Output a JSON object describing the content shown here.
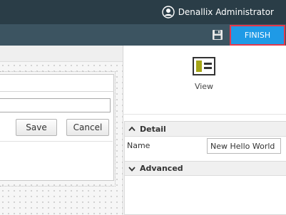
{
  "header": {
    "user_name": "Denallix Administrator",
    "avatar_icon": "user-circle-icon"
  },
  "toolbar": {
    "save_icon": "floppy-disk-icon",
    "finish_label": "FINISH",
    "finish_color": "#1f9ae6",
    "highlight_color": "#e5384a"
  },
  "canvas": {
    "text_input_value": "",
    "save_button_label": "Save",
    "cancel_button_label": "Cancel"
  },
  "side_panel": {
    "view_icon": "view-layout-icon",
    "view_label": "View",
    "sections": {
      "detail": {
        "title": "Detail",
        "expanded": true,
        "name_label": "Name",
        "name_value": "New Hello World"
      },
      "advanced": {
        "title": "Advanced",
        "expanded": true
      }
    }
  }
}
